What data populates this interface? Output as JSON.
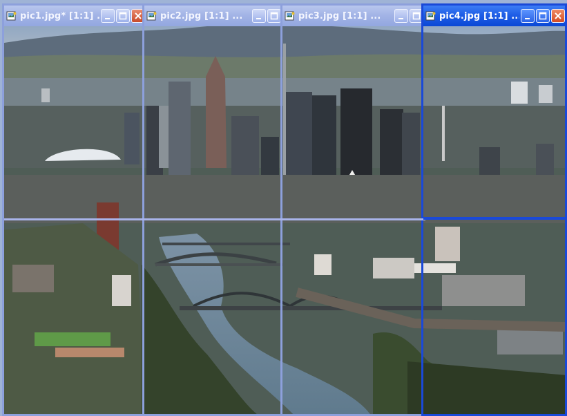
{
  "windows": [
    {
      "title": "pic1.jpg* [1:1] ...",
      "active": false
    },
    {
      "title": "pic2.jpg [1:1] ...",
      "active": false
    },
    {
      "title": "pic3.jpg [1:1] ...",
      "active": false
    },
    {
      "title": "pic4.jpg [1:1] ...",
      "active": true
    }
  ],
  "icons": {
    "app": "picture-file-icon",
    "minimize": "minimize-icon",
    "maximize": "maximize-icon",
    "close": "close-icon"
  },
  "colors": {
    "active_title": "#0a48d6",
    "inactive_title": "#a3b4e6",
    "active_border": "#1a49d8",
    "inactive_border": "#8da0dc",
    "close_button": "#d44c25"
  }
}
